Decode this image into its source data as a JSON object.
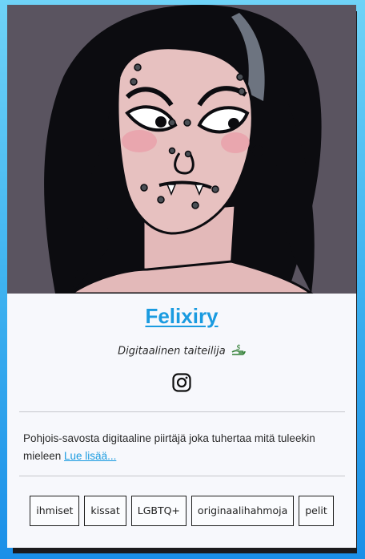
{
  "profile": {
    "name": "Felixiry",
    "tagline": "Digitaalinen taiteilija",
    "tagline_emoji": "hand-with-money-icon",
    "social": [
      "instagram-icon"
    ],
    "bio_text": "Pohjois-savosta digitaaline piirtäjä joka tuhertaa mitä tuleekin mieleen ",
    "bio_link": "Lue lisää..."
  },
  "tags": [
    "ihmiset",
    "kissat",
    "LGBTQ+",
    "originaalihahmoja",
    "pelit"
  ],
  "colors": {
    "accent": "#1a9be0",
    "background_gradient_top": "#6fd3f7",
    "background_gradient_bottom": "#1a8fe8",
    "card": "#f7f8fc",
    "portrait_bg": "#5a5460"
  }
}
